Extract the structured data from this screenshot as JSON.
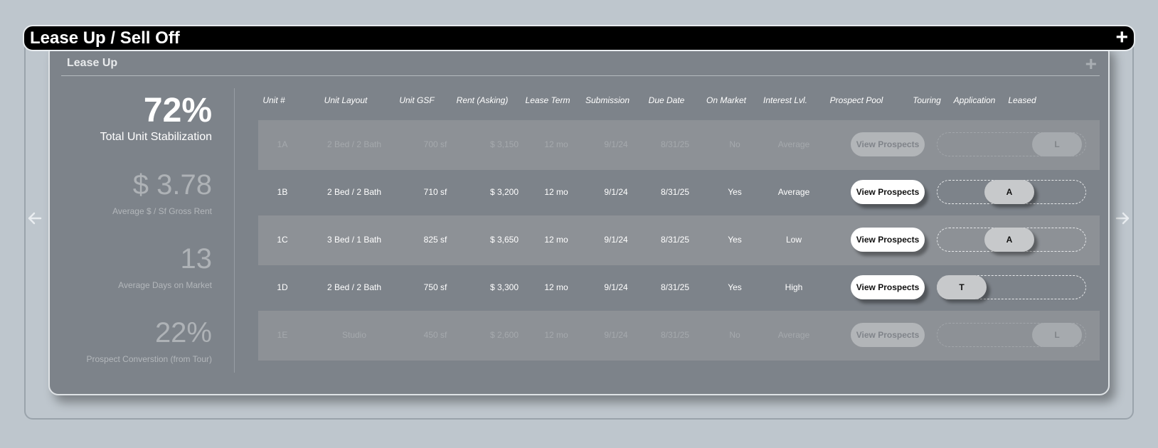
{
  "window": {
    "title": "Lease Up / Sell Off",
    "expand_icon": "plus-icon"
  },
  "card": {
    "title": "Lease Up",
    "expand_icon": "plus-icon"
  },
  "stats": [
    {
      "value": "72%",
      "label": "Total Unit Stabilization"
    },
    {
      "value": "$ 3.78",
      "label": "Average $ / Sf Gross Rent"
    },
    {
      "value": "13",
      "label": "Average Days on Market"
    },
    {
      "value": "22%",
      "label": "Prospect Converstion (from Tour)"
    }
  ],
  "columns": [
    "Unit #",
    "Unit Layout",
    "Unit GSF",
    "Rent (Asking)",
    "Lease Term",
    "Submission",
    "Due Date",
    "On Market",
    "Interest Lvl.",
    "Prospect Pool",
    "Touring",
    "Application",
    "Leased"
  ],
  "button_label": "View Prospects",
  "rows": [
    {
      "unit": "1A",
      "layout": "2 Bed / 2 Bath",
      "gsf": "700 sf",
      "rent": "$ 3,150",
      "term": "12 mo",
      "submission": "9/1/24",
      "due": "8/31/25",
      "on_market": "No",
      "interest": "Average",
      "stage": "L",
      "stage_name": "Leased",
      "active": false
    },
    {
      "unit": "1B",
      "layout": "2 Bed / 2 Bath",
      "gsf": "710 sf",
      "rent": "$ 3,200",
      "term": "12 mo",
      "submission": "9/1/24",
      "due": "8/31/25",
      "on_market": "Yes",
      "interest": "Average",
      "stage": "A",
      "stage_name": "Application",
      "active": true
    },
    {
      "unit": "1C",
      "layout": "3 Bed / 1 Bath",
      "gsf": "825 sf",
      "rent": "$ 3,650",
      "term": "12 mo",
      "submission": "9/1/24",
      "due": "8/31/25",
      "on_market": "Yes",
      "interest": "Low",
      "stage": "A",
      "stage_name": "Application",
      "active": true
    },
    {
      "unit": "1D",
      "layout": "2 Bed / 2 Bath",
      "gsf": "750 sf",
      "rent": "$ 3,300",
      "term": "12 mo",
      "submission": "9/1/24",
      "due": "8/31/25",
      "on_market": "Yes",
      "interest": "High",
      "stage": "T",
      "stage_name": "Touring",
      "active": true
    },
    {
      "unit": "1E",
      "layout": "Studio",
      "gsf": "450 sf",
      "rent": "$ 2,600",
      "term": "12 mo",
      "submission": "9/1/24",
      "due": "8/31/25",
      "on_market": "No",
      "interest": "Average",
      "stage": "L",
      "stage_name": "Leased",
      "active": false
    }
  ],
  "nav": {
    "prev_icon": "arrow-left-icon",
    "next_icon": "arrow-right-icon"
  },
  "colors": {
    "title_bar": "#000000",
    "card": "#7d838a",
    "shaded_row": "#8d9196",
    "page_bg": "#bec6cd"
  }
}
